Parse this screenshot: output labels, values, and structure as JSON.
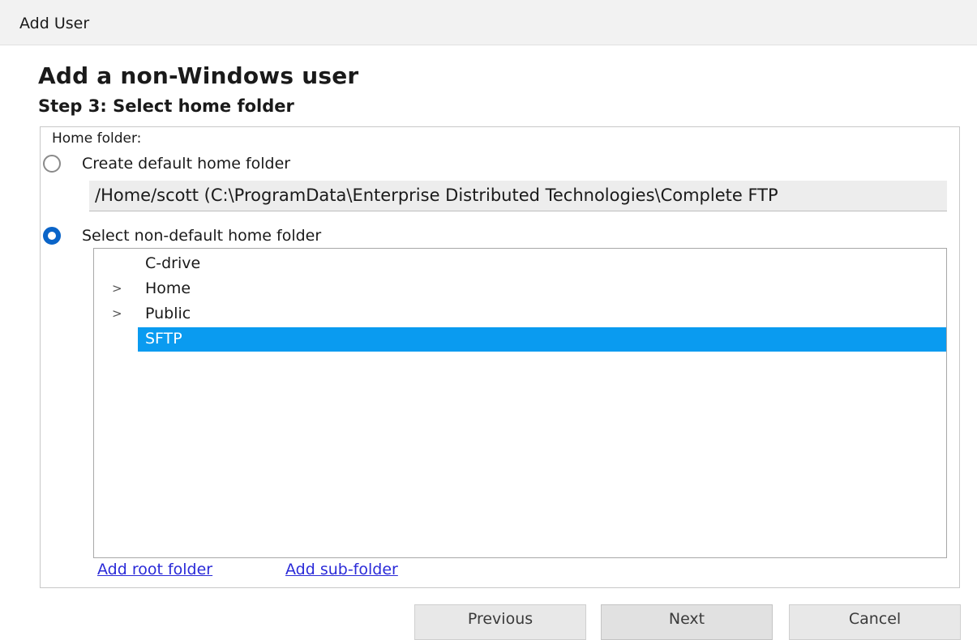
{
  "window": {
    "title": "Add User"
  },
  "header": {
    "heading": "Add a non-Windows user",
    "subheading": "Step 3: Select home folder"
  },
  "home_folder": {
    "group_label": "Home folder:",
    "option_default": {
      "label": "Create default home folder",
      "checked": false
    },
    "default_path": "/Home/scott (C:\\ProgramData\\Enterprise Distributed Technologies\\Complete FTP",
    "option_custom": {
      "label": "Select non-default home folder",
      "checked": true
    }
  },
  "tree": {
    "items": [
      {
        "label": "C-drive",
        "expander": "",
        "selected": false
      },
      {
        "label": "Home",
        "expander": ">",
        "selected": false
      },
      {
        "label": "Public",
        "expander": ">",
        "selected": false
      },
      {
        "label": "SFTP",
        "expander": "",
        "selected": true
      }
    ]
  },
  "links": {
    "add_root": "Add root folder",
    "add_sub": "Add sub-folder"
  },
  "buttons": {
    "previous": "Previous",
    "next": "Next",
    "cancel": "Cancel"
  },
  "colors": {
    "selection": "#0a9bf0",
    "radio_checked": "#0a64c8",
    "link": "#2a2ad8"
  }
}
